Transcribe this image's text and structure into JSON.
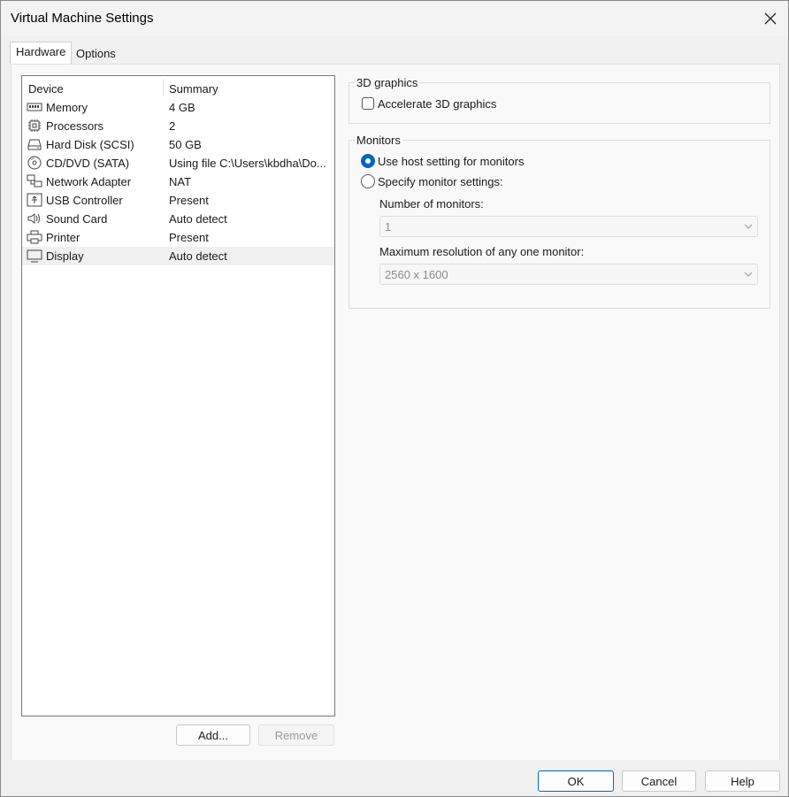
{
  "window": {
    "title": "Virtual Machine Settings"
  },
  "tabs": [
    {
      "label": "Hardware"
    },
    {
      "label": "Options"
    }
  ],
  "device_list": {
    "headers": {
      "device": "Device",
      "summary": "Summary"
    },
    "rows": [
      {
        "name": "Memory",
        "summary": "4 GB",
        "icon": "memory-icon"
      },
      {
        "name": "Processors",
        "summary": "2",
        "icon": "processor-icon"
      },
      {
        "name": "Hard Disk (SCSI)",
        "summary": "50 GB",
        "icon": "hard-disk-icon"
      },
      {
        "name": "CD/DVD (SATA)",
        "summary": "Using file C:\\Users\\kbdha\\Do...",
        "icon": "cd-dvd-icon"
      },
      {
        "name": "Network Adapter",
        "summary": "NAT",
        "icon": "network-adapter-icon"
      },
      {
        "name": "USB Controller",
        "summary": "Present",
        "icon": "usb-icon"
      },
      {
        "name": "Sound Card",
        "summary": "Auto detect",
        "icon": "speaker-icon"
      },
      {
        "name": "Printer",
        "summary": "Present",
        "icon": "printer-icon"
      },
      {
        "name": "Display",
        "summary": "Auto detect",
        "icon": "monitor-icon",
        "selected": true
      }
    ]
  },
  "list_buttons": {
    "add": "Add...",
    "remove": "Remove"
  },
  "graphics": {
    "title": "3D graphics",
    "accelerate_label": "Accelerate 3D graphics",
    "accelerate_checked": false
  },
  "monitors": {
    "title": "Monitors",
    "use_host_label": "Use host setting for monitors",
    "specify_label": "Specify monitor settings:",
    "selected_option": "use_host",
    "number_label": "Number of monitors:",
    "number_value": "1",
    "max_res_label": "Maximum resolution of any one monitor:",
    "max_res_value": "2560 x 1600"
  },
  "footer": {
    "ok": "OK",
    "cancel": "Cancel",
    "help": "Help"
  },
  "colors": {
    "accent": "#0067c0",
    "selected_row": "#f0f0f0"
  }
}
